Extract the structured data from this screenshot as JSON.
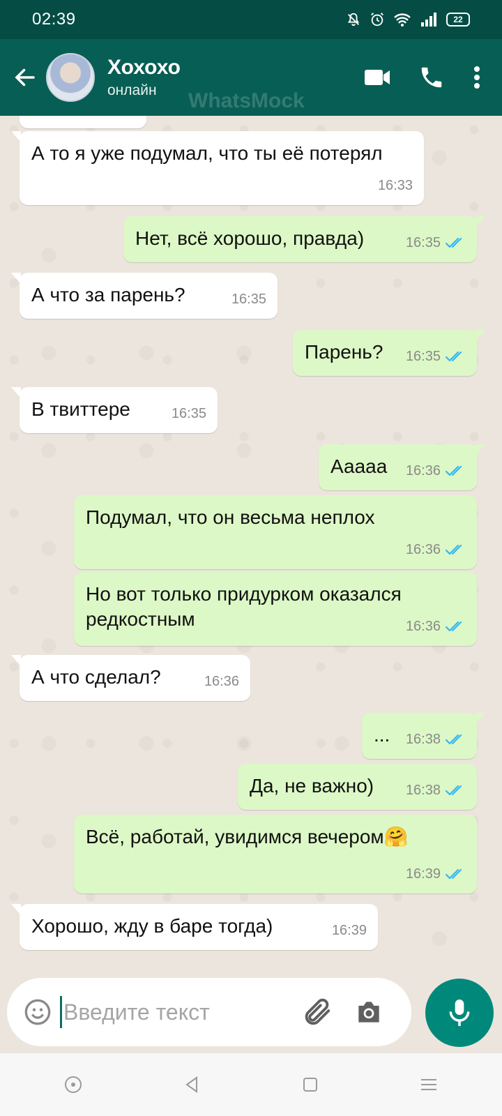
{
  "status_bar": {
    "time": "02:39",
    "battery": "22"
  },
  "header": {
    "contact_name": "Хохохо",
    "contact_status": "онлайн",
    "watermark": "WhatsMock"
  },
  "messages": [
    {
      "dir": "in",
      "text": "",
      "time": "16:33",
      "partial": true
    },
    {
      "dir": "in",
      "text": "А то я уже подумал, что ты её потерял",
      "time": "16:33"
    },
    {
      "dir": "out",
      "text": "Нет, всё хорошо, правда)",
      "time": "16:35",
      "read": true
    },
    {
      "dir": "in",
      "text": "А что за парень?",
      "time": "16:35"
    },
    {
      "dir": "out",
      "text": "Парень?",
      "time": "16:35",
      "read": true
    },
    {
      "dir": "in",
      "text": "В твиттере",
      "time": "16:35"
    },
    {
      "dir": "out",
      "text": "Ааааа",
      "time": "16:36",
      "read": true
    },
    {
      "dir": "out",
      "text": "Подумал, что он весьма неплох",
      "time": "16:36",
      "read": true
    },
    {
      "dir": "out",
      "text": "Но вот только придурком оказался редкостным",
      "time": "16:36",
      "read": true
    },
    {
      "dir": "in",
      "text": "А что сделал?",
      "time": "16:36"
    },
    {
      "dir": "out",
      "text": "...",
      "time": "16:38",
      "read": true
    },
    {
      "dir": "out",
      "text": "Да, не важно)",
      "time": "16:38",
      "read": true
    },
    {
      "dir": "out",
      "text": "Всё, работай, увидимся вечером🤗",
      "time": "16:39",
      "read": true
    },
    {
      "dir": "in",
      "text": "Хорошо, жду в баре тогда)",
      "time": "16:39"
    }
  ],
  "composer": {
    "placeholder": "Введите текст"
  },
  "colors": {
    "header": "#075e54",
    "status_bar": "#054d44",
    "outgoing_bubble": "#dcf8c6",
    "incoming_bubble": "#ffffff",
    "read_ticks": "#34b7f1",
    "mic_button": "#00897b"
  },
  "icons": {
    "back": "arrow-left-icon",
    "video": "video-call-icon",
    "call": "phone-icon",
    "menu": "more-vertical-icon",
    "emoji": "emoji-icon",
    "attach": "paperclip-icon",
    "camera": "camera-icon",
    "mic": "microphone-icon"
  }
}
